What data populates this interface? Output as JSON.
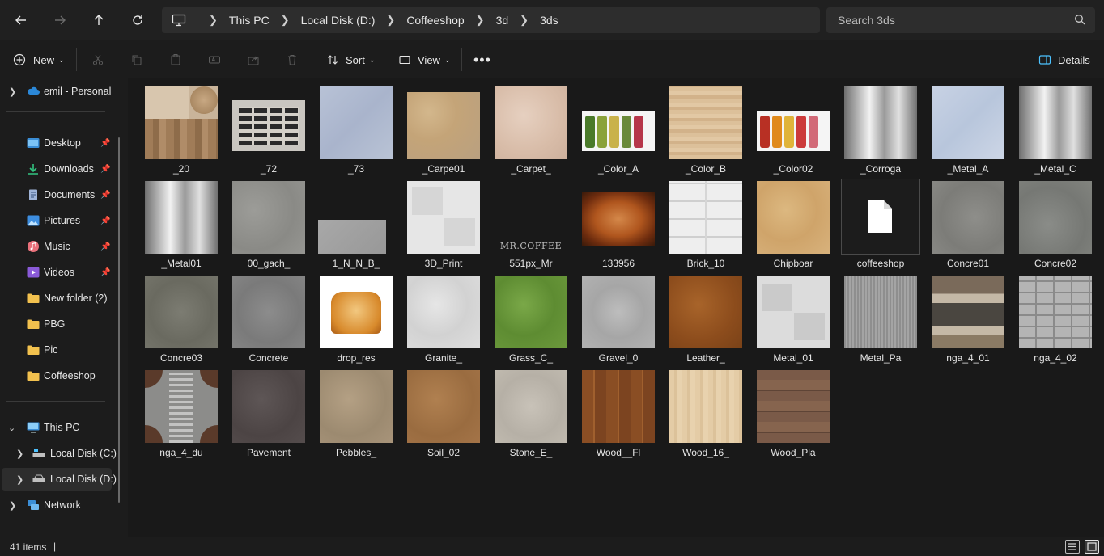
{
  "nav": {
    "back_icon": "arrow-left-icon",
    "forward_icon": "arrow-right-icon",
    "up_icon": "arrow-up-icon",
    "refresh_icon": "refresh-icon"
  },
  "breadcrumb": [
    "This PC",
    "Local Disk (D:)",
    "Coffeeshop",
    "3d",
    "3ds"
  ],
  "search": {
    "placeholder": "Search 3ds"
  },
  "toolbar": {
    "new_label": "New",
    "sort_label": "Sort",
    "view_label": "View",
    "details_label": "Details"
  },
  "sidebar": {
    "account": "emil - Personal",
    "quick_access": [
      "Desktop",
      "Downloads",
      "Documents",
      "Pictures",
      "Music",
      "Videos",
      "New folder (2)",
      "PBG",
      "Pic",
      "Coffeeshop"
    ],
    "this_pc": "This PC",
    "drives": [
      "Local Disk (C:)",
      "Local Disk (D:)"
    ],
    "network": "Network"
  },
  "files": [
    {
      "name": "_20"
    },
    {
      "name": "_72"
    },
    {
      "name": "_73"
    },
    {
      "name": "_Carpe01"
    },
    {
      "name": "_Carpet_"
    },
    {
      "name": "_Color_A"
    },
    {
      "name": "_Color_B"
    },
    {
      "name": "_Color02"
    },
    {
      "name": "_Corroga"
    },
    {
      "name": "_Metal_A"
    },
    {
      "name": "_Metal_C"
    },
    {
      "name": "_Metal01"
    },
    {
      "name": "00_gach_"
    },
    {
      "name": "1_N_N_B_"
    },
    {
      "name": "3D_Print"
    },
    {
      "name": "551px_Mr",
      "overlay": "MR.COFFEE"
    },
    {
      "name": "133956"
    },
    {
      "name": "Brick_10"
    },
    {
      "name": "Chipboar"
    },
    {
      "name": "coffeeshop"
    },
    {
      "name": "Concre01"
    },
    {
      "name": "Concre02"
    },
    {
      "name": "Concre03"
    },
    {
      "name": "Concrete"
    },
    {
      "name": "drop_res"
    },
    {
      "name": "Granite_"
    },
    {
      "name": "Grass_C_"
    },
    {
      "name": "Gravel_0"
    },
    {
      "name": "Leather_"
    },
    {
      "name": "Metal_01"
    },
    {
      "name": "Metal_Pa"
    },
    {
      "name": "nga_4_01"
    },
    {
      "name": "nga_4_02"
    },
    {
      "name": "nga_4_du"
    },
    {
      "name": "Pavement"
    },
    {
      "name": "Pebbles_"
    },
    {
      "name": "Soil_02"
    },
    {
      "name": "Stone_E_"
    },
    {
      "name": "Wood__Fl"
    },
    {
      "name": "Wood_16_"
    },
    {
      "name": "Wood_Pla"
    }
  ],
  "status": {
    "item_count": "41 items"
  },
  "colors": {
    "background": "#191919",
    "panel": "#202020",
    "accent": "#4cc2ff",
    "folder": "#f2c14e"
  }
}
